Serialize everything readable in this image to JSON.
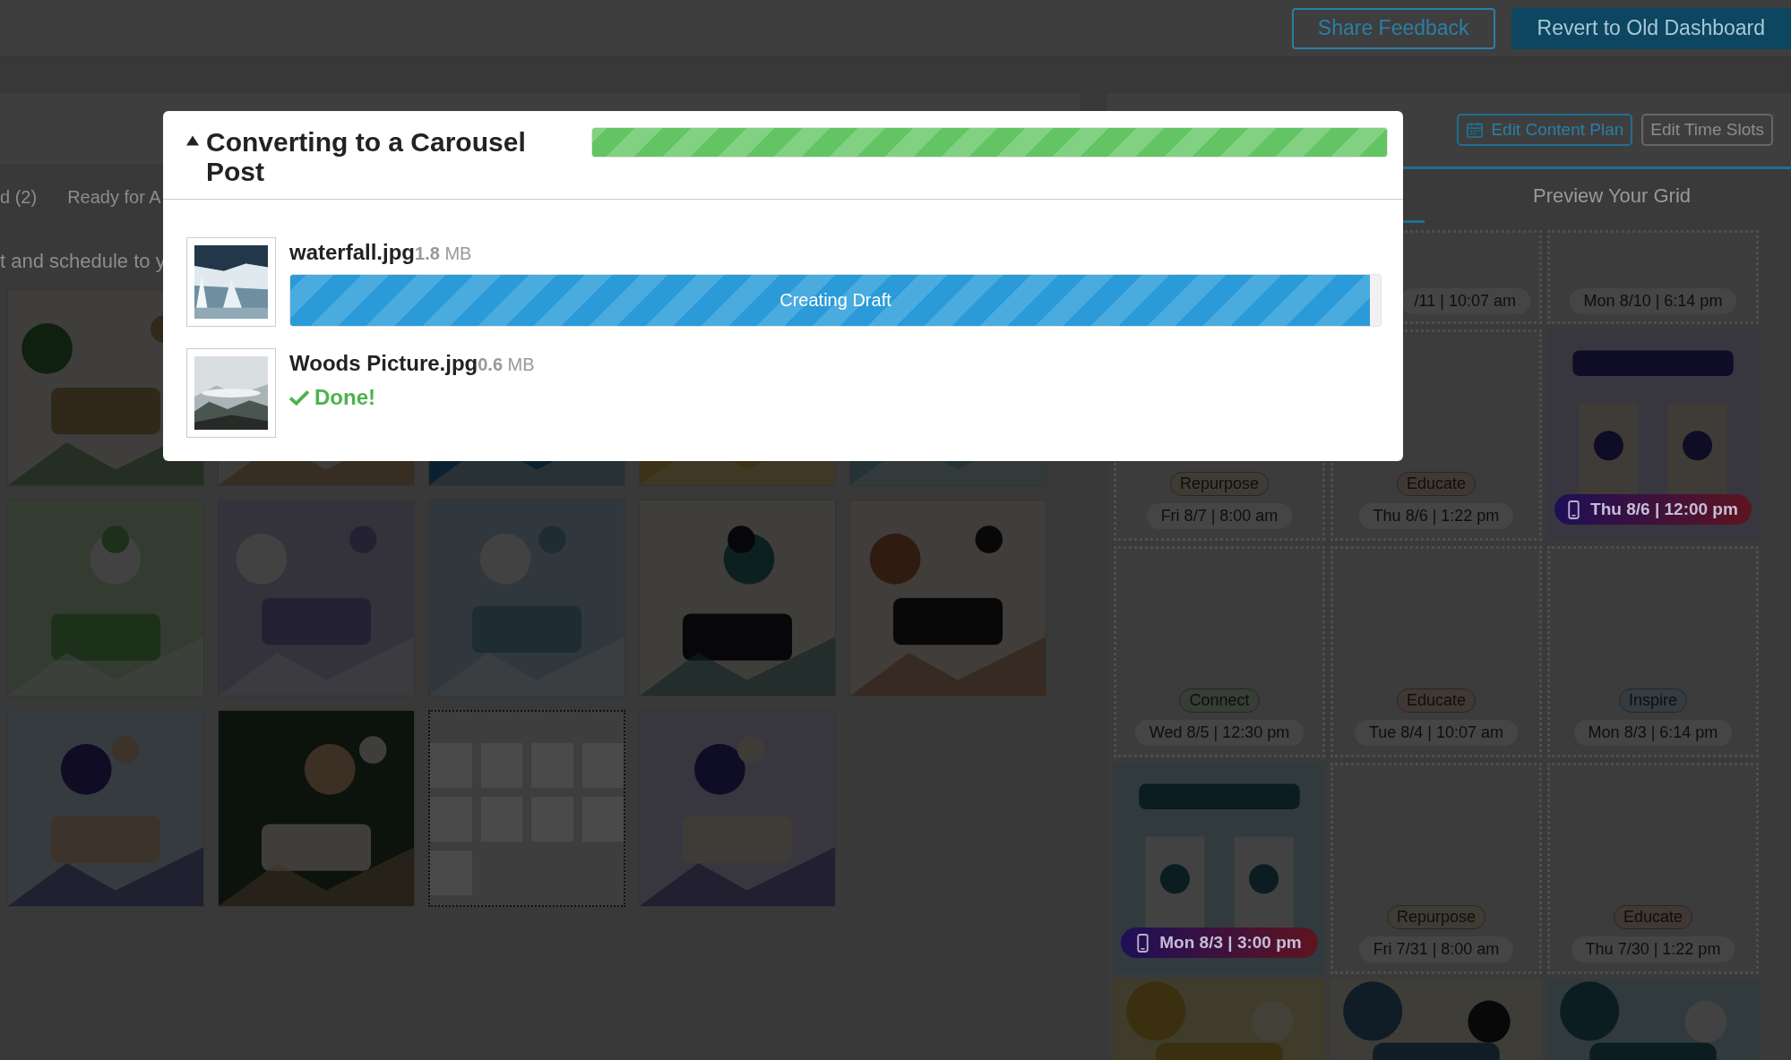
{
  "top_bar": {
    "buttons": [
      {
        "label": "Share Feedback",
        "kind": "outline"
      },
      {
        "label": "Revert to Old Dashboard",
        "kind": "solid"
      }
    ]
  },
  "drafts_panel": {
    "tabs": [
      {
        "label": "d (2)",
        "selected": false
      },
      {
        "label": "Ready for A",
        "selected": false
      }
    ],
    "hint": "t and schedule to y",
    "posts": [
      {
        "kind": "picture"
      },
      {
        "kind": "picture"
      },
      {
        "kind": "picture"
      },
      {
        "kind": "picture"
      },
      {
        "kind": "picture"
      },
      {
        "kind": "picture"
      },
      {
        "kind": "picture"
      },
      {
        "kind": "picture"
      },
      {
        "kind": "picture"
      },
      {
        "kind": "picture"
      },
      {
        "kind": "picture"
      },
      {
        "kind": "picture"
      },
      {
        "kind": "placeholder"
      },
      {
        "kind": "picture"
      }
    ]
  },
  "plan_panel": {
    "buttons": [
      {
        "label": "Edit Content Plan",
        "kind": "calendar"
      },
      {
        "label": "Edit Time Slots",
        "kind": "plain"
      }
    ],
    "tabs": [
      {
        "label": "Preview Your Grid",
        "selected": false
      }
    ],
    "slots": [
      {
        "kind": "time",
        "time": "/11 | 10:07 am"
      },
      {
        "kind": "time",
        "time": "Mon 8/10 | 6:14 pm"
      },
      {
        "kind": "slot",
        "tag": "Repurpose",
        "color": "#3f3c33",
        "time": "Fri 8/7 | 8:00 am"
      },
      {
        "kind": "slot",
        "tag": "Educate",
        "color": "#413833",
        "time": "Thu 8/6 | 1:22 pm"
      },
      {
        "kind": "post",
        "time": "Thu 8/6 | 12:00 pm"
      },
      {
        "kind": "slot",
        "tag": "Connect",
        "color": "#373e35",
        "time": "Wed 8/5 | 12:30 pm"
      },
      {
        "kind": "slot",
        "tag": "Educate",
        "color": "#413833",
        "time": "Tue 8/4 | 10:07 am"
      },
      {
        "kind": "slot",
        "tag": "Inspire",
        "color": "#343c42",
        "time": "Mon 8/3 | 6:14 pm"
      },
      {
        "kind": "post",
        "time": "Mon 8/3 | 3:00 pm"
      },
      {
        "kind": "slot",
        "tag": "Repurpose",
        "color": "#3f3c33",
        "time": "Fri 7/31 | 8:00 am"
      },
      {
        "kind": "slot",
        "tag": "Educate",
        "color": "#413833",
        "time": "Thu 7/30 | 1:22 pm"
      },
      {
        "kind": "picture"
      },
      {
        "kind": "picture"
      },
      {
        "kind": "picture"
      }
    ]
  },
  "modal": {
    "title": "Converting to a Carousel Post",
    "expanded": true,
    "level": 1,
    "files": [
      {
        "name": "waterfall.jpg",
        "size": "**1.8** MB",
        "kind": "progress",
        "label": "Creating Draft",
        "level": 0.99
      },
      {
        "name": "Woods Picture.jpg",
        "size": "**0.6** MB",
        "kind": "done",
        "label": "Done!"
      }
    ]
  }
}
